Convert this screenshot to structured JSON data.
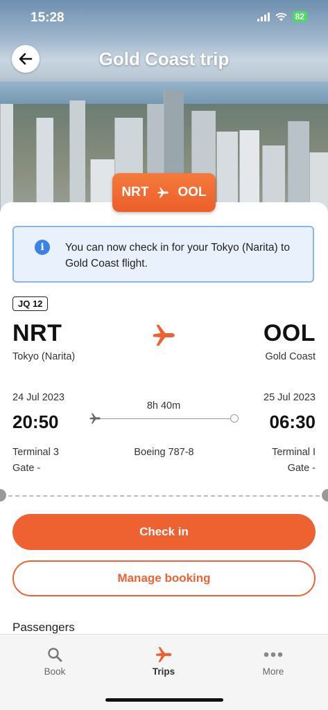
{
  "status": {
    "time": "15:28",
    "battery": "82"
  },
  "header": {
    "title": "Gold Coast trip"
  },
  "route_tag": {
    "from": "NRT",
    "to": "OOL"
  },
  "notice": {
    "text": "You can now check in for your Tokyo (Narita) to Gold Coast flight."
  },
  "flight": {
    "number": "JQ 12",
    "origin": {
      "code": "NRT",
      "city": "Tokyo (Narita)",
      "date": "24 Jul 2023",
      "time": "20:50",
      "terminal": "Terminal 3",
      "gate": "Gate -"
    },
    "destination": {
      "code": "OOL",
      "city": "Gold Coast",
      "date": "25 Jul 2023",
      "time": "06:30",
      "terminal": "Terminal I",
      "gate": "Gate -"
    },
    "duration": "8h 40m",
    "aircraft": "Boeing 787-8"
  },
  "actions": {
    "check_in": "Check in",
    "manage": "Manage booking"
  },
  "passengers": {
    "title": "Passengers"
  },
  "tabs": [
    {
      "label": "Book",
      "icon": "search-icon"
    },
    {
      "label": "Trips",
      "icon": "plane-icon"
    },
    {
      "label": "More",
      "icon": "more-icon"
    }
  ],
  "colors": {
    "accent": "#ee6232",
    "info_bg": "#e9f1fd",
    "info_border": "#8ab4ee"
  }
}
